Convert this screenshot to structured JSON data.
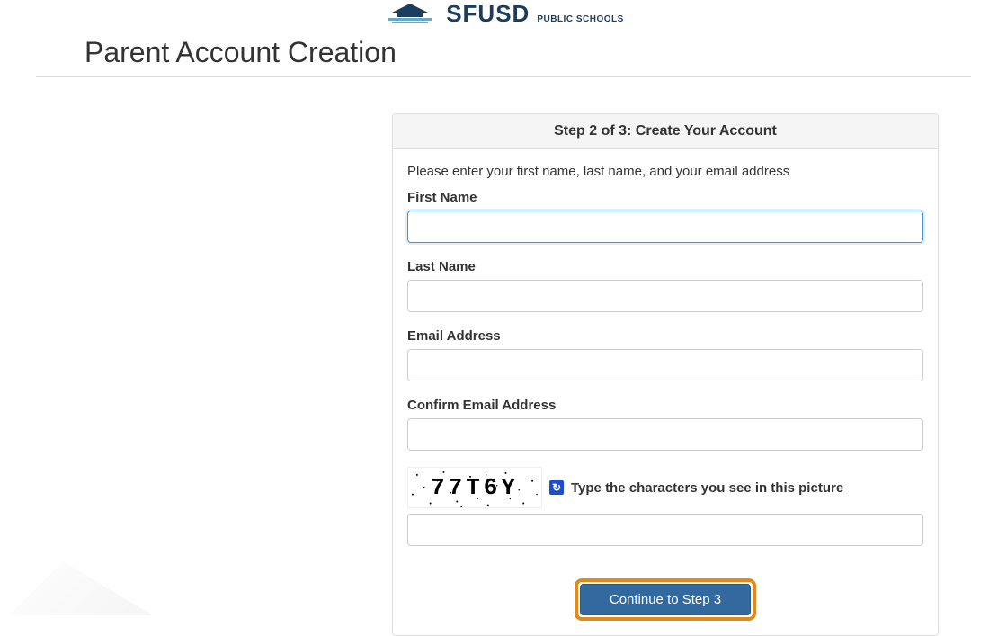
{
  "logo": {
    "main": "SFUSD",
    "subtitle": "PUBLIC SCHOOLS"
  },
  "page_title": "Parent Account Creation",
  "card": {
    "header": "Step 2 of 3: Create Your Account",
    "intro": "Please enter your first name, last name, and your email address",
    "fields": {
      "first_name": {
        "label": "First Name",
        "value": ""
      },
      "last_name": {
        "label": "Last Name",
        "value": ""
      },
      "email": {
        "label": "Email Address",
        "value": ""
      },
      "confirm_email": {
        "label": "Confirm Email Address",
        "value": ""
      }
    },
    "captcha": {
      "text": "77T6Y",
      "label": "Type the characters you see in this picture",
      "input_value": ""
    },
    "continue_button": "Continue to Step 3"
  }
}
